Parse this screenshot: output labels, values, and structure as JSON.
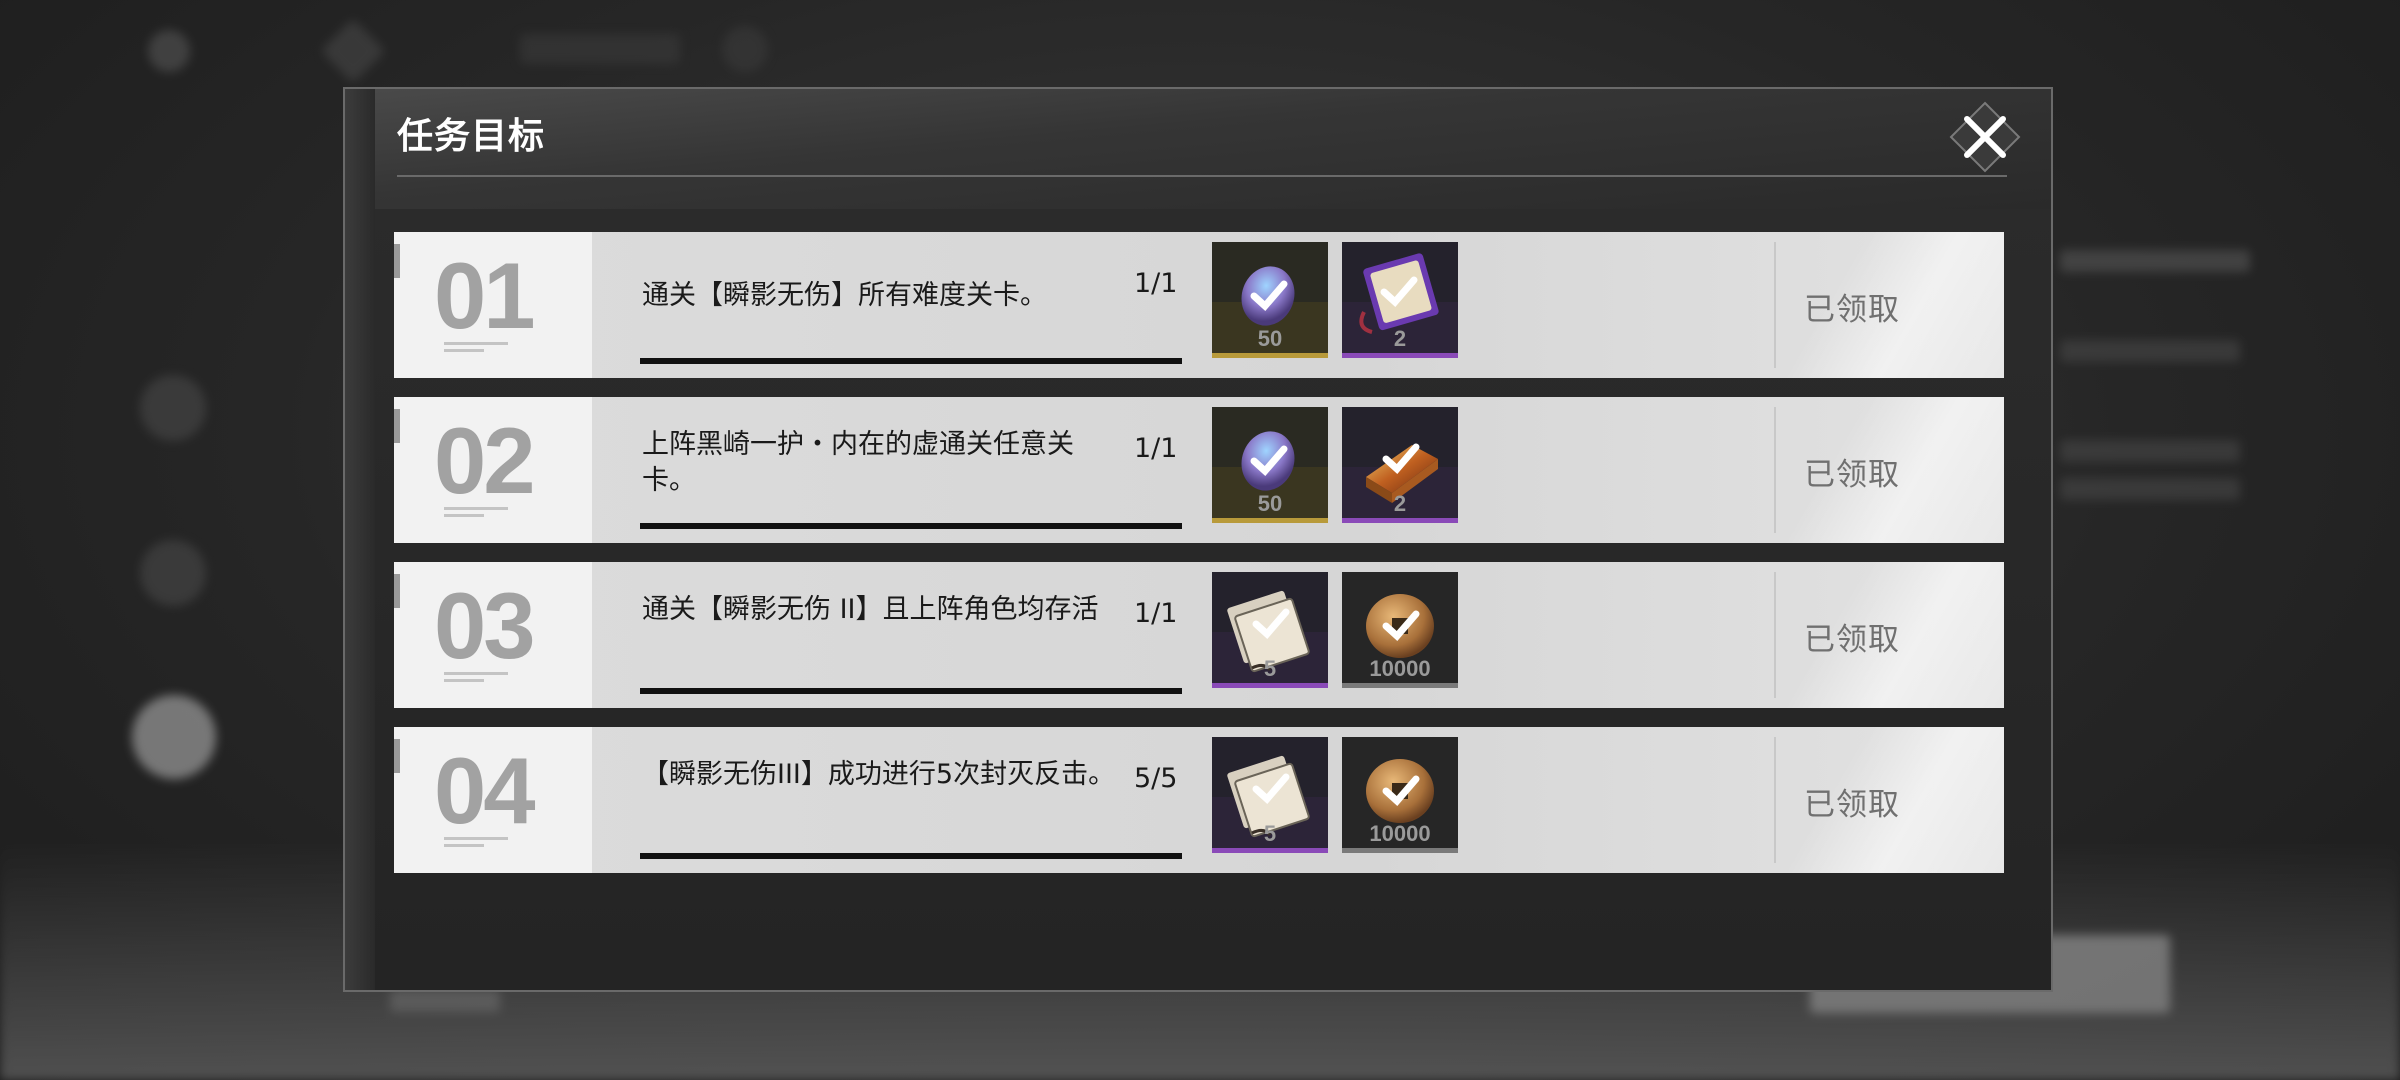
{
  "modal": {
    "title": "任务目标",
    "close_icon": "close-x-icon"
  },
  "colors": {
    "gold_strip": "#b89a3a",
    "purple_strip": "#8a4ab8",
    "gray_strip": "#7a7a7a",
    "row_bg": "#d8d8d8",
    "number_color": "#a2a2a2"
  },
  "tasks": [
    {
      "number": "01",
      "description": "通关【瞬影无伤】所有难度关卡。",
      "progress": "1/1",
      "status": "已领取",
      "rewards": [
        {
          "icon": "crystal-coin-icon",
          "qty": "50",
          "rarity": "gold"
        },
        {
          "icon": "purple-ticket-icon",
          "qty": "2",
          "rarity": "purple"
        }
      ]
    },
    {
      "number": "02",
      "description": "上阵黑崎一护・内在的虚通关任意关卡。",
      "progress": "1/1",
      "status": "已领取",
      "rewards": [
        {
          "icon": "crystal-coin-icon",
          "qty": "50",
          "rarity": "gold"
        },
        {
          "icon": "gold-bar-icon",
          "qty": "2",
          "rarity": "purple"
        }
      ]
    },
    {
      "number": "03",
      "description": "通关【瞬影无伤 II】且上阵角色均存活",
      "progress": "1/1",
      "status": "已领取",
      "rewards": [
        {
          "icon": "scroll-book-icon",
          "qty": "5",
          "rarity": "purple"
        },
        {
          "icon": "bronze-coin-icon",
          "qty": "10000",
          "rarity": "gray"
        }
      ]
    },
    {
      "number": "04",
      "description": "【瞬影无伤III】成功进行5次封灭反击。",
      "progress": "5/5",
      "status": "已领取",
      "rewards": [
        {
          "icon": "scroll-book-icon",
          "qty": "5",
          "rarity": "purple"
        },
        {
          "icon": "bronze-coin-icon",
          "qty": "10000",
          "rarity": "gray"
        }
      ]
    }
  ]
}
